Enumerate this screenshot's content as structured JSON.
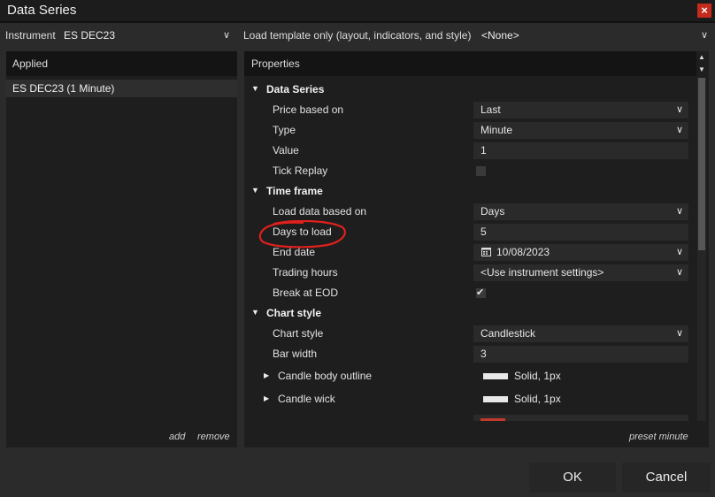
{
  "window": {
    "title": "Data Series",
    "close_glyph": "×"
  },
  "instrument": {
    "label": "Instrument",
    "value": "ES DEC23"
  },
  "template": {
    "label": "Load template only (layout, indicators, and style)",
    "value": "<None>"
  },
  "applied": {
    "header": "Applied",
    "items": [
      "ES DEC23 (1 Minute)"
    ],
    "add_label": "add",
    "remove_label": "remove"
  },
  "properties": {
    "header": "Properties",
    "preset_label": "preset minute",
    "categories": [
      {
        "name": "Data Series",
        "rows": [
          {
            "label": "Price based on",
            "value": "Last",
            "kind": "dropdown"
          },
          {
            "label": "Type",
            "value": "Minute",
            "kind": "dropdown"
          },
          {
            "label": "Value",
            "value": "1",
            "kind": "text"
          },
          {
            "label": "Tick Replay",
            "checked": false,
            "kind": "checkbox"
          }
        ]
      },
      {
        "name": "Time frame",
        "rows": [
          {
            "label": "Load data based on",
            "value": "Days",
            "kind": "dropdown"
          },
          {
            "label": "Days to load",
            "value": "5",
            "kind": "text"
          },
          {
            "label": "End date",
            "value": "10/08/2023",
            "kind": "date"
          },
          {
            "label": "Trading hours",
            "value": "<Use instrument settings>",
            "kind": "dropdown"
          },
          {
            "label": "Break at EOD",
            "checked": true,
            "kind": "checkbox"
          }
        ]
      },
      {
        "name": "Chart style",
        "rows": [
          {
            "label": "Chart style",
            "value": "Candlestick",
            "kind": "dropdown"
          },
          {
            "label": "Bar width",
            "value": "3",
            "kind": "text"
          },
          {
            "label": "Candle body outline",
            "value": "Solid, 1px",
            "kind": "stroke"
          },
          {
            "label": "Candle wick",
            "value": "Solid, 1px",
            "kind": "stroke"
          }
        ]
      }
    ]
  },
  "buttons": {
    "ok": "OK",
    "cancel": "Cancel"
  },
  "colors": {
    "background": "#2b2b2b",
    "panel": "#1e1e1e",
    "annotation": "#e0201c",
    "close": "#c42b1c"
  }
}
